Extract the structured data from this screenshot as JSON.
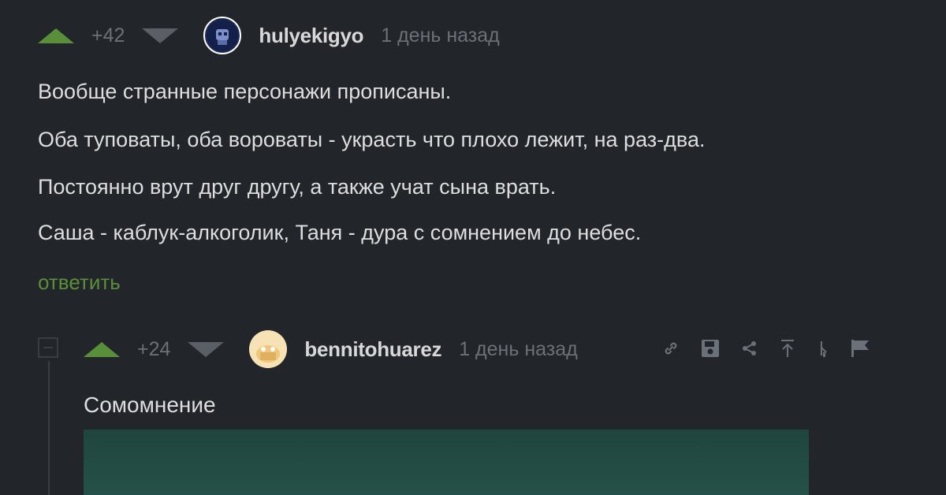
{
  "comment1": {
    "score": "+42",
    "username": "hulyekigyo",
    "time": "1 день назад",
    "lines": [
      "Вообще странные персонажи прописаны.",
      "Оба туповаты, оба вороваты - украсть что плохо лежит, на раз-два.",
      "Постоянно врут друг другу, а также учат сына врать.",
      "Саша - каблук-алкоголик, Таня - дура с сомнением до небес."
    ],
    "reply_label": "ответить"
  },
  "comment2": {
    "score": "+24",
    "username": "bennitohuarez",
    "time": "1 день назад",
    "title": "Сомомнение",
    "tools": [
      "link-icon",
      "save-icon",
      "share-icon",
      "to-top-icon",
      "hand-icon",
      "flag-icon"
    ]
  },
  "colors": {
    "background": "#222529",
    "accent_green": "#5a8f3a",
    "muted": "#6b7178",
    "text": "#dedede"
  }
}
